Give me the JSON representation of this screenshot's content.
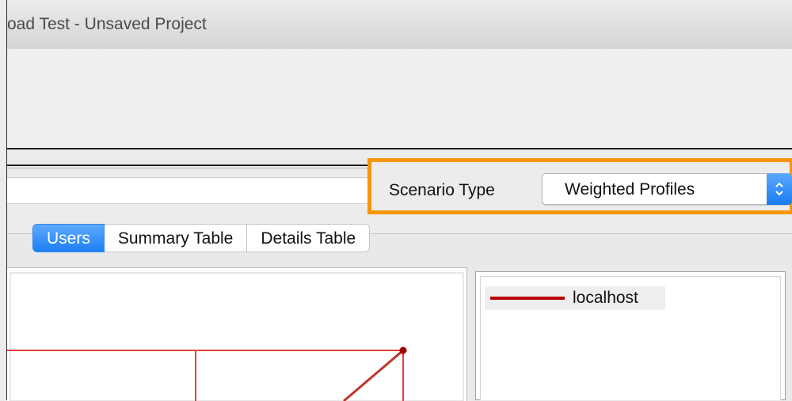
{
  "window": {
    "title": "oad Test - Unsaved Project"
  },
  "scenario": {
    "label": "Scenario Type",
    "selected": "Weighted Profiles"
  },
  "tabs": [
    {
      "label": "Users",
      "active": true
    },
    {
      "label": "Summary Table",
      "active": false
    },
    {
      "label": "Details Table",
      "active": false
    }
  ],
  "legend": {
    "items": [
      {
        "label": "localhost",
        "color": "#b80000"
      }
    ]
  },
  "colors": {
    "accent": "#1c7ff4",
    "highlight_border": "#f7940b",
    "chart_line": "#e8403a",
    "chart_series": "#c0352b"
  },
  "icons": {
    "select_stepper": "up-down-chevron-icon"
  }
}
